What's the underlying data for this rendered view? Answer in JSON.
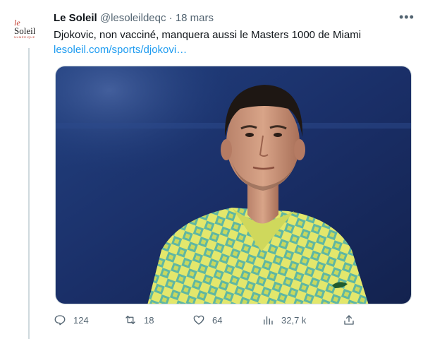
{
  "account": {
    "avatar_text": "le Soleil",
    "avatar_sub": "NUMÉRIQUE",
    "name": "Le Soleil",
    "handle": "@lesoleildeqc",
    "separator": "·",
    "date": "18 mars"
  },
  "more_label": "•••",
  "tweet": {
    "text": "Djokovic, non vacciné, manquera aussi le Masters 1000 de Miami",
    "link": "lesoleil.com/sports/djokovi…"
  },
  "media": {
    "icon": "photo-tennis-player",
    "colors": {
      "background": "#1c3470",
      "shirt_yellow": "#dfe46a",
      "shirt_teal": "#3fa99b"
    }
  },
  "actions": {
    "reply": {
      "icon": "reply-icon",
      "count": "124"
    },
    "retweet": {
      "icon": "retweet-icon",
      "count": "18"
    },
    "like": {
      "icon": "heart-icon",
      "count": "64"
    },
    "views": {
      "icon": "views-icon",
      "count": "32,7 k"
    },
    "share": {
      "icon": "share-icon"
    }
  },
  "colors": {
    "link": "#1d9bf0",
    "muted": "#536471",
    "text": "#0f1419"
  }
}
